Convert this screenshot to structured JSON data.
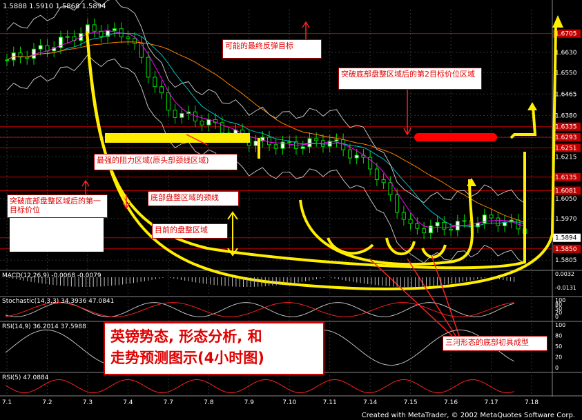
{
  "header": {
    "ohlc": "1.5888 1.5910 1.5868 1.5894"
  },
  "colors": {
    "price_up": "#00e000",
    "price_down": "#00e000",
    "ma_fast": "#ff00ff",
    "ma_mid": "#00c0c0",
    "ma_slow": "#ff8000",
    "bands": "#c0c0c0",
    "hline": "#c00000",
    "yellow": "#ffee00"
  },
  "annotations": {
    "rebound_target": "可能的最终反弹目标",
    "second_target": "突破底部盘整区域后的第2目标价位区域",
    "strongest_resistance": "最强的阻力区域(原头部颈线区域)",
    "first_target": "突破底部盘整区域后的第一目标价位",
    "neckline": "底部盘整区域的颈线",
    "current_range": "目前的盘整区域",
    "triple_bottom": "三河形态的底部初具成型"
  },
  "titlebox": {
    "line1": "英镑势态,  形态分析,  和",
    "line2": "走势预测图示(4小时图)"
  },
  "panels": {
    "macd": "MACD(12,26,9) -0.0068 -0.0079",
    "stoch": "Stochastic(14,3,3) 34.3936 47.0841",
    "rsi14": "RSI(14,9) 36.2014 37.5988",
    "rsi5": "RSI(5) 47.0884"
  },
  "footer": "Created with MetaTrader, © 2002 MetaQuotes Software Corp.",
  "chart_data": {
    "type": "line",
    "title": "",
    "categories": [
      "7.1",
      "7.2",
      "7.3",
      "7.4",
      "7.7",
      "7.8",
      "7.9",
      "7.10",
      "7.11",
      "7.14",
      "7.15",
      "7.16",
      "7.17",
      "7.18"
    ],
    "y_ticks": [
      "1.6630",
      "1.6550",
      "1.6465",
      "1.6380",
      "1.6295",
      "1.6215",
      "1.6050",
      "1.5970",
      "1.5805"
    ],
    "marked_levels": [
      "1.6705",
      "1.6335",
      "1.6293",
      "1.6251",
      "1.6135",
      "1.6081",
      "1.5894",
      "1.5850"
    ],
    "macd_ticks": [
      "0.0032",
      "-0.0131"
    ],
    "osc_ticks": [
      "100",
      "80",
      "50",
      "20",
      "0"
    ],
    "last_price": "1.5894",
    "series": [
      {
        "name": "price",
        "values": [
          1.66,
          1.665,
          1.672,
          1.67,
          1.64,
          1.635,
          1.628,
          1.626,
          1.628,
          1.618,
          1.593,
          1.594,
          1.597,
          1.592
        ]
      }
    ],
    "ylim": [
      1.577,
      1.68
    ]
  }
}
